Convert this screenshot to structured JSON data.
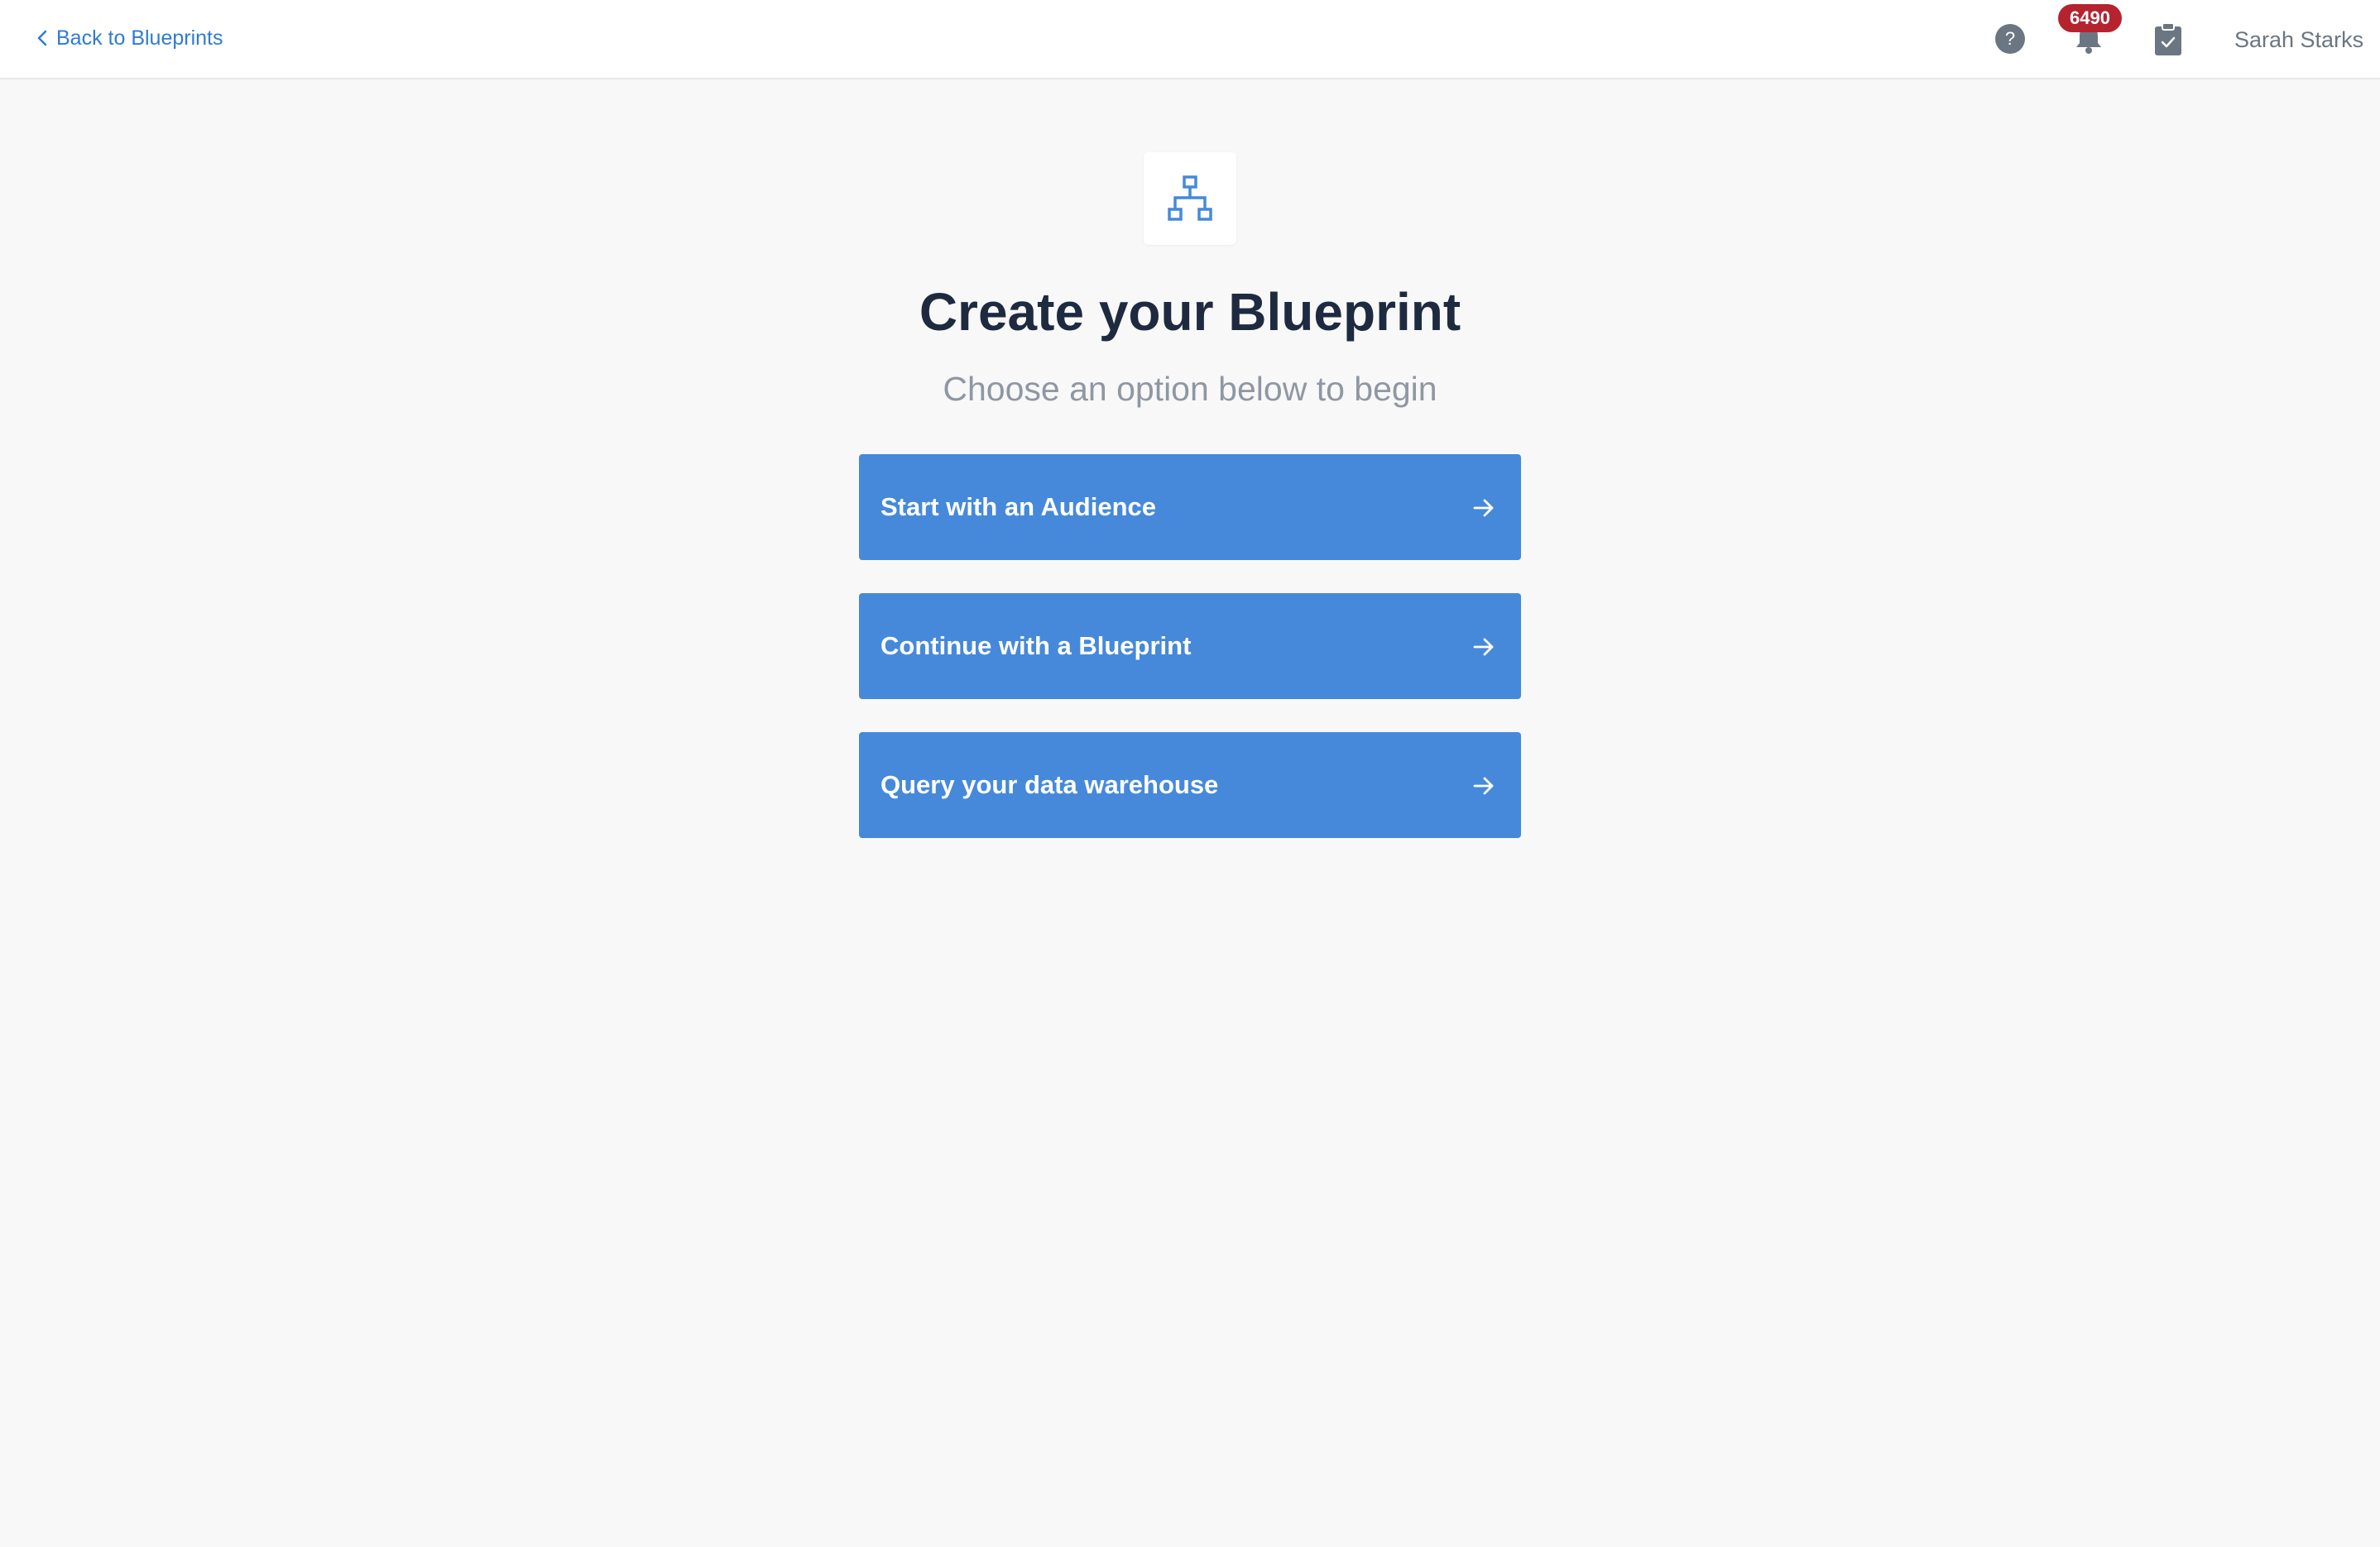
{
  "header": {
    "back_label": "Back to Blueprints",
    "notification_count": "6490",
    "user_name": "Sarah Starks",
    "icons": {
      "back": "chevron-left-icon",
      "help": "help-icon",
      "notifications": "bell-icon",
      "tasks": "clipboard-check-icon"
    },
    "colors": {
      "link": "#2f7bd4",
      "badge": "#b5232f",
      "icon": "#6b7683"
    }
  },
  "main": {
    "logo_icon": "sitemap-icon",
    "title": "Create your Blueprint",
    "subtitle": "Choose an option below to begin",
    "options": [
      {
        "label": "Start with an Audience",
        "icon": "arrow-right-icon"
      },
      {
        "label": "Continue with a Blueprint",
        "icon": "arrow-right-icon"
      },
      {
        "label": "Query your data warehouse",
        "icon": "arrow-right-icon"
      }
    ],
    "colors": {
      "accent": "#4689da",
      "title": "#1e2a40",
      "subtitle": "#8f97a3",
      "background": "#f8f8f8"
    }
  }
}
